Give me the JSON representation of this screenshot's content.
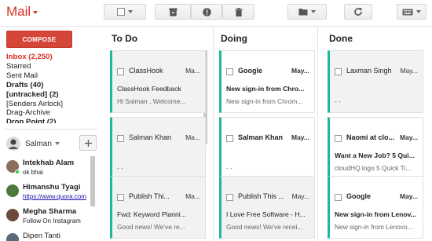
{
  "app": {
    "brand": "Mail"
  },
  "sidebar": {
    "compose_label": "COMPOSE",
    "labels": [
      {
        "text": "Inbox (2,250)",
        "style": "active"
      },
      {
        "text": "Starred",
        "style": ""
      },
      {
        "text": "Sent Mail",
        "style": ""
      },
      {
        "text": "Drafts (40)",
        "style": "bold"
      },
      {
        "text": "[untracked] (2)",
        "style": "bold"
      },
      {
        "text": "[Senders Airlock]",
        "style": ""
      },
      {
        "text": "Drag-Archive",
        "style": ""
      },
      {
        "text": "Drop Point (2)",
        "style": "bold"
      }
    ],
    "user": {
      "name": "Salman"
    },
    "contacts": [
      {
        "name": "Intekhab Alam",
        "status": "ok bhai",
        "link": false,
        "online": true,
        "avatar_color": "#8a6d5a"
      },
      {
        "name": "Himanshu Tyagi",
        "status": "https://www.quora.com",
        "link": true,
        "online": false,
        "avatar_color": "#4b7a3c"
      },
      {
        "name": "Megha Sharma",
        "status": "Follow On Instagram",
        "link": false,
        "online": false,
        "avatar_color": "#6b4a3a"
      },
      {
        "name": "Dipen Tanti",
        "status": "",
        "link": false,
        "online": false,
        "avatar_color": "#5a6a7a"
      }
    ]
  },
  "board": {
    "columns": [
      {
        "title": "To Do",
        "cards": [
          {
            "from": "ClassHook",
            "from_bold": false,
            "date": "Ma...",
            "date_bold": false,
            "subject": "ClassHook Feedback",
            "subject_bold": false,
            "snippet": "Hi Salman , Welcome...",
            "white": false
          },
          {
            "from": "Salman Khan",
            "from_bold": false,
            "date": "Ma...",
            "date_bold": false,
            "subject": "",
            "subject_bold": false,
            "snippet": "- -",
            "white": false
          },
          {
            "from": "Publish Thi...",
            "from_bold": false,
            "date": "Ma...",
            "date_bold": false,
            "subject": "Fwd: Keyword Planni...",
            "subject_bold": false,
            "snippet": "Good news! We've re...",
            "white": false
          }
        ]
      },
      {
        "title": "Doing",
        "cards": [
          {
            "from": "Google",
            "from_bold": true,
            "date": "May...",
            "date_bold": true,
            "subject": "New sign-in from Chro...",
            "subject_bold": true,
            "snippet": "New sign-in from Chrom...",
            "white": true
          },
          {
            "from": "Salman Khan",
            "from_bold": true,
            "date": "May...",
            "date_bold": true,
            "subject": "",
            "subject_bold": false,
            "snippet": "- -",
            "white": true
          },
          {
            "from": "Publish This ...",
            "from_bold": false,
            "date": "May...",
            "date_bold": false,
            "subject": "I Love Free Software - H...",
            "subject_bold": false,
            "snippet": "Good news! We've recei...",
            "white": false
          }
        ]
      },
      {
        "title": "Done",
        "cards": [
          {
            "from": "Laxman Singh",
            "from_bold": false,
            "date": "May...",
            "date_bold": false,
            "subject": "",
            "subject_bold": false,
            "snippet": "- -",
            "white": false
          },
          {
            "from": "Naomi at clo...",
            "from_bold": true,
            "date": "May...",
            "date_bold": true,
            "subject": "Want a New Job? 5 Qui...",
            "subject_bold": true,
            "snippet": "cloudHQ logo 5 Quick Ti...",
            "white": true
          },
          {
            "from": "Google",
            "from_bold": true,
            "date": "May...",
            "date_bold": true,
            "subject": "New sign-in from Lenov...",
            "subject_bold": true,
            "snippet": "New sign-in from Lenovo...",
            "white": true
          }
        ]
      }
    ]
  },
  "colors": {
    "brand": "#d93025",
    "compose": "#d44638",
    "card_accent": "#1fb99a"
  }
}
